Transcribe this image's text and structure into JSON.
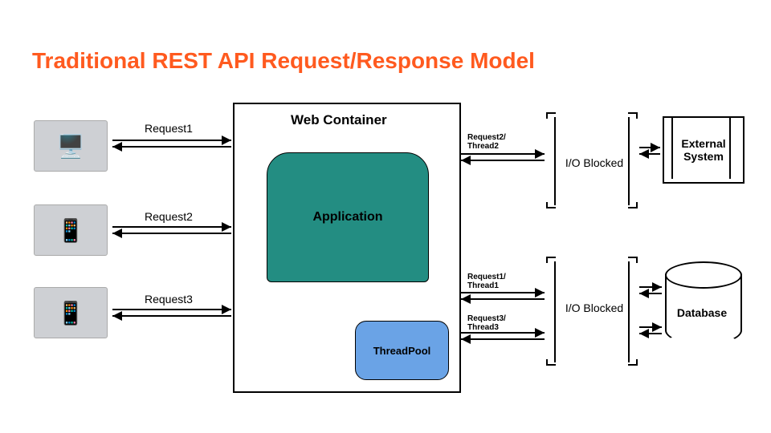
{
  "title": "Traditional REST API Request/Response Model",
  "clients": {
    "desktop_icon": "🖥️",
    "tablet_icon": "📱",
    "phone_icon": "📱"
  },
  "left_requests": {
    "r1": "Request1",
    "r2": "Request2",
    "r3": "Request3"
  },
  "container": {
    "title": "Web Container",
    "application_label": "Application",
    "threadpool_label": "ThreadPool"
  },
  "right_labels": {
    "r2t2": "Request2/\nThread2",
    "r1t1": "Request1/\nThread1",
    "r3t3": "Request3/\nThread3"
  },
  "io": {
    "top": "I/O Blocked",
    "bottom": "I/O Blocked"
  },
  "external": {
    "line1": "External",
    "line2": "System"
  },
  "database": {
    "label": "Database"
  },
  "colors": {
    "title": "#ff5a1f",
    "application": "#238d82",
    "threadpool": "#6aa3e6"
  }
}
